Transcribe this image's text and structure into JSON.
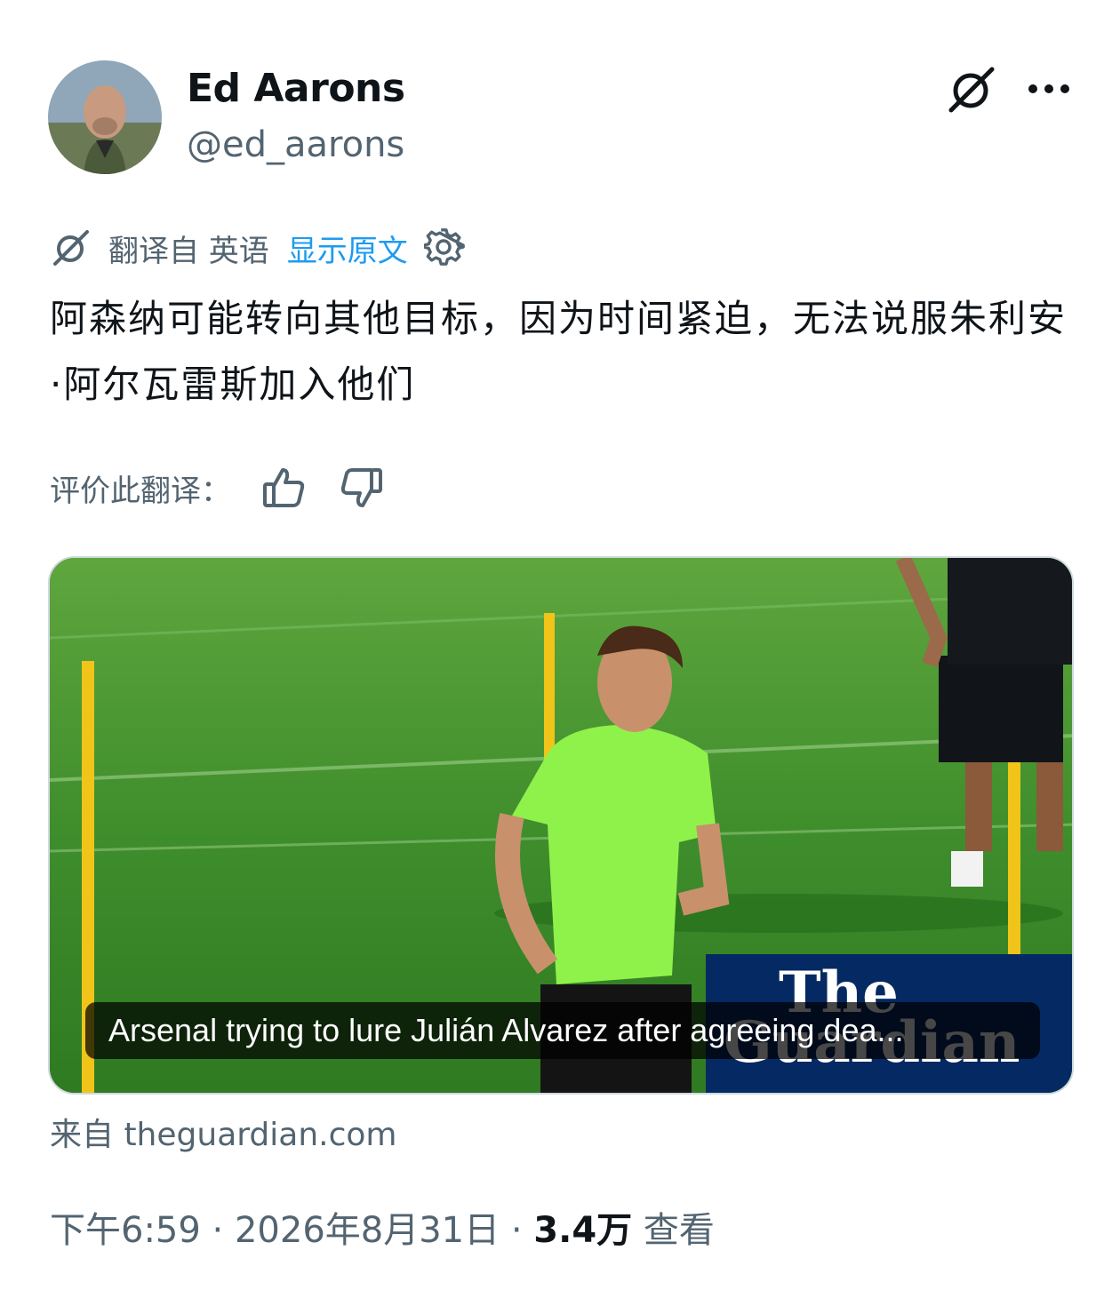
{
  "author": {
    "name": "Ed Aarons",
    "handle": "@ed_aarons"
  },
  "icons": {
    "grok": "grok-icon",
    "more": "more-options-icon",
    "translate": "translate-icon",
    "settings": "gear-icon",
    "thumbs_up": "thumbs-up-icon",
    "thumbs_down": "thumbs-down-icon"
  },
  "translation": {
    "translated_from": "翻译自 英语",
    "show_original": "显示原文",
    "rate_label": "评价此翻译："
  },
  "tweet": {
    "text": "阿森纳可能转向其他目标，因为时间紧迫，无法说服朱利安·阿尔瓦雷斯加入他们"
  },
  "card": {
    "title": "Arsenal trying to lure Julián Alvarez after agreeing dea...",
    "logo_line1": "The",
    "logo_line2": "Guardian",
    "source": "来自 theguardian.com"
  },
  "meta": {
    "time": "下午6:59",
    "sep1": " · ",
    "date": "2026年8月31日",
    "sep2": " · ",
    "views_count": "3.4万",
    "views_label": " 查看"
  },
  "colors": {
    "text": "#0f1419",
    "secondary": "#536471",
    "link": "#1d9bf0",
    "guardian_blue": "#052962"
  }
}
